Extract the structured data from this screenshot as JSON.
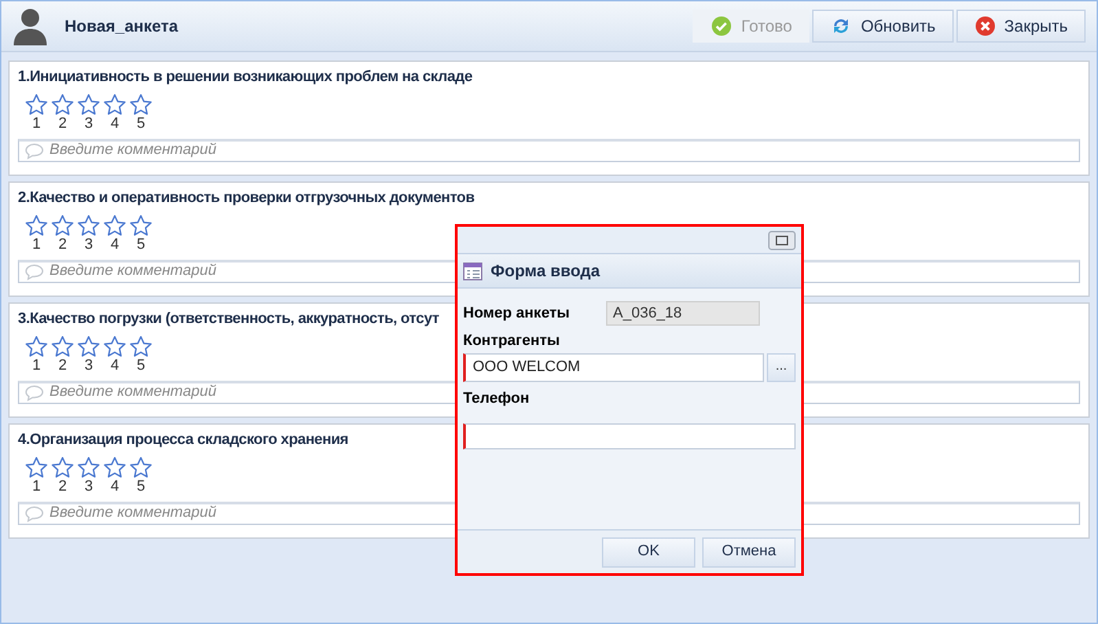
{
  "header": {
    "title": "Новая_анкета",
    "buttons": [
      {
        "label": "Готово",
        "kind": "done",
        "disabled": true
      },
      {
        "label": "Обновить",
        "kind": "refresh",
        "disabled": false
      },
      {
        "label": "Закрыть",
        "kind": "close",
        "disabled": false
      }
    ]
  },
  "questions": [
    {
      "title": "1.Инициативность в решении возникающих проблем на складе",
      "stars": 0,
      "scale": [
        "1",
        "2",
        "3",
        "4",
        "5"
      ],
      "comment_placeholder": "Введите комментарий"
    },
    {
      "title": "2.Качество и оперативность проверки отгрузочных документов",
      "stars": 0,
      "scale": [
        "1",
        "2",
        "3",
        "4",
        "5"
      ],
      "comment_placeholder": "Введите комментарий"
    },
    {
      "title": "3.Качество погрузки (ответственность, аккуратность, отсут",
      "stars": 0,
      "scale": [
        "1",
        "2",
        "3",
        "4",
        "5"
      ],
      "comment_placeholder": "Введите комментарий"
    },
    {
      "title": "4.Организация процесса складского хранения",
      "stars": 0,
      "scale": [
        "1",
        "2",
        "3",
        "4",
        "5"
      ],
      "comment_placeholder": "Введите комментарий"
    }
  ],
  "dialog": {
    "title": "Форма ввода",
    "fields": [
      {
        "label": "Номер анкеты",
        "value": "A_036_18",
        "kind": "readonly"
      },
      {
        "label": "Контрагенты",
        "value": "ООО WELCOM",
        "kind": "lookup",
        "lookup_button": "...",
        "required": true
      },
      {
        "label": "Телефон",
        "kind": "text",
        "required": true
      }
    ],
    "buttons": [
      "OK",
      "Отмена"
    ]
  }
}
